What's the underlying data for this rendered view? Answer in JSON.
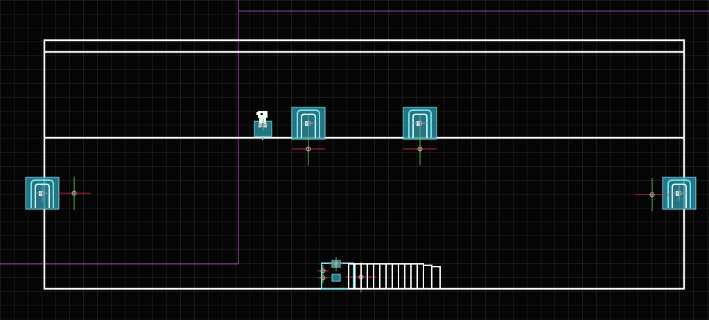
{
  "colors": {
    "background": "#050505",
    "grid": "#464646",
    "room_outline": "#ffffff",
    "region_outline": "#b455c8",
    "entity_fill": "#2a8a9a",
    "entity_stroke": "#7fe6f2",
    "gizmo_x": "#e0303a",
    "gizmo_y": "#5ad048",
    "gizmo_center": "#c8c8c8"
  },
  "icons": {
    "door": "door-icon",
    "player": "player-sprite-icon",
    "pivot": "pivot-gizmo-icon",
    "stairs": "stairs-icon",
    "small_box": "small-entity-icon"
  }
}
